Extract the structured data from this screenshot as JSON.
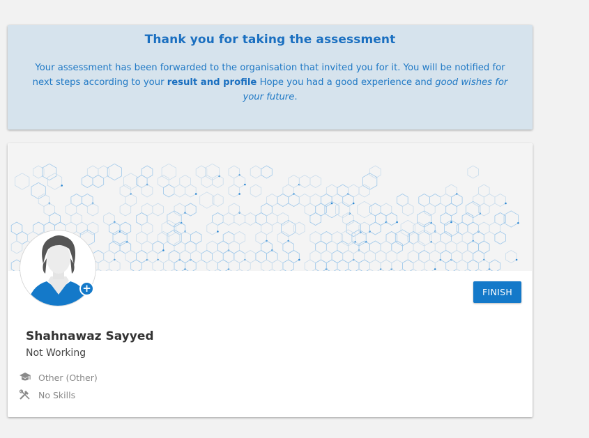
{
  "notice": {
    "title": "Thank you for taking the assessment",
    "text_1": "Your assessment has been forwarded to the organisation that invited you for it. You will be notified for next steps according to your ",
    "text_bold": "result and profile",
    "text_2": " Hope you had a good experience and ",
    "text_italic": "good wishes for your future",
    "text_end": "."
  },
  "profile": {
    "name": "Shahnawaz Sayyed",
    "status": "Not Working",
    "education": "Other (Other)",
    "skills": "No Skills",
    "add_photo_symbol": "+"
  },
  "actions": {
    "finish_label": "FINISH"
  },
  "icons": {
    "education": "graduation-cap-icon",
    "skills": "skills-tools-icon",
    "add": "plus-icon"
  },
  "colors": {
    "accent": "#1479c9",
    "notice_bg": "#d6e3ed",
    "page_bg": "#f2f2f2"
  }
}
